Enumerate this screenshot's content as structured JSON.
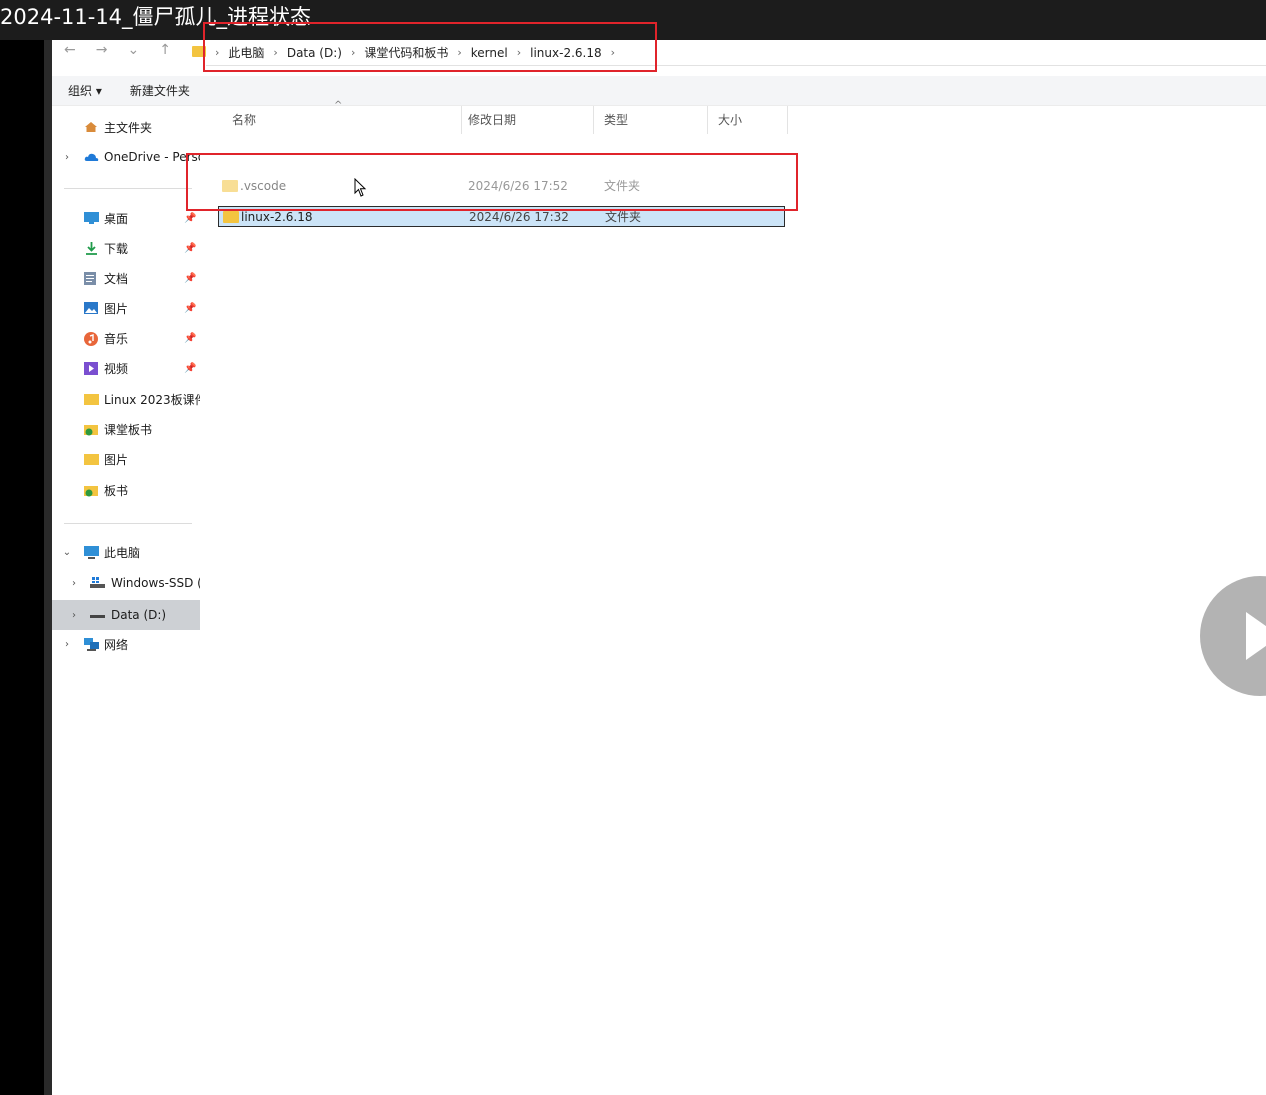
{
  "video": {
    "title": "2024-11-14_僵尸孤儿_进程状态"
  },
  "address_bar": {
    "crumbs": [
      "此电脑",
      "Data (D:)",
      "课堂代码和板书",
      "kernel",
      "linux-2.6.18"
    ]
  },
  "toolbar": {
    "organize": "组织 ▾",
    "new_folder": "新建文件夹"
  },
  "nav": {
    "home": "主文件夹",
    "onedrive": "OneDrive - Perso",
    "pinned": [
      "桌面",
      "下载",
      "文档",
      "图片",
      "音乐",
      "视频"
    ],
    "folders": [
      "Linux 2023板课件",
      "课堂板书",
      "图片",
      "板书"
    ],
    "this_pc": "此电脑",
    "drives": [
      "Windows-SSD (C",
      "Data (D:)"
    ],
    "network": "网络"
  },
  "columns": {
    "name": "名称",
    "date": "修改日期",
    "type": "类型",
    "size": "大小"
  },
  "files": [
    {
      "name": ".vscode",
      "date": "2024/6/26 17:52",
      "type": "文件夹"
    },
    {
      "name": "linux-2.6.18",
      "date": "2024/6/26 17:32",
      "type": "文件夹"
    }
  ],
  "colors": {
    "folder": "#f3c440",
    "selection": "#cce4f7",
    "annotation": "#e0242b"
  }
}
